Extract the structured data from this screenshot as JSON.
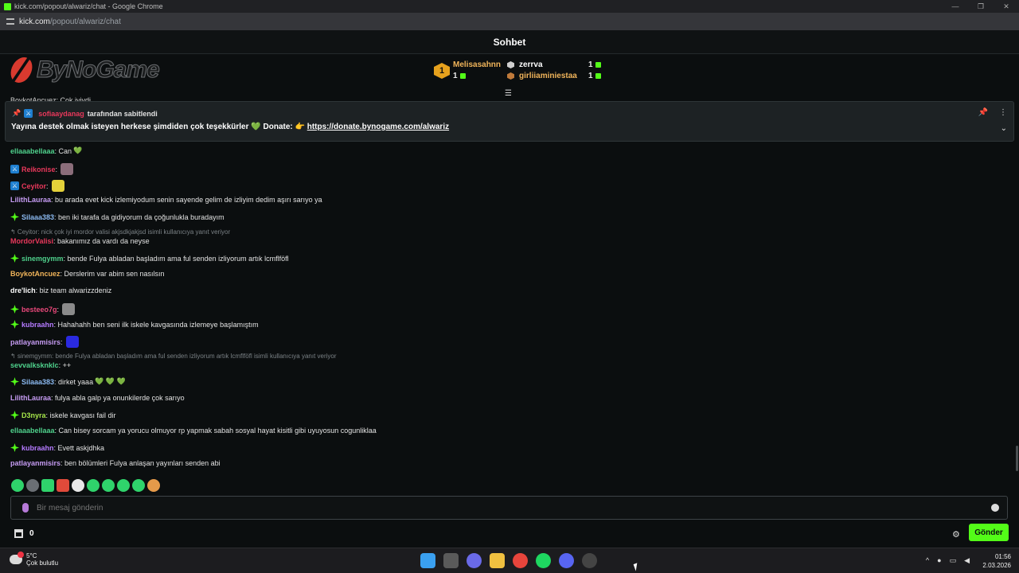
{
  "browser": {
    "window_title": "kick.com/popout/alwariz/chat - Google Chrome",
    "url_host": "kick.com",
    "url_path": "/popout/alwariz/chat"
  },
  "header": {
    "title": "Sohbet"
  },
  "logo": {
    "text": "ByNoGame"
  },
  "gifters": {
    "first": {
      "rank": "1",
      "name": "Melisasahnn",
      "count": "1"
    },
    "second": {
      "name": "zerrva",
      "count": "1"
    },
    "third": {
      "name": "girliiaminiestaa",
      "count": "1"
    }
  },
  "top_clip_text": "BoykotAncuez: Çok iyiydi",
  "pinned": {
    "pinned_by_user": "sofiaaydanag",
    "pinned_by_suffix": "tarafından sabitlendi",
    "text": "Yayına destek olmak isteyen herkese şimdiden çok teşekkürler 💚 Donate: 👉",
    "link": "https://donate.bynogame.com/alwariz"
  },
  "messages": [
    {
      "user": "ellaaabellaaa",
      "color": "#4fd18c",
      "text": ": Can",
      "heart": "💚"
    },
    {
      "user": "Reikonise",
      "color": "#e8385b",
      "text": ":",
      "mod": true,
      "emote": "#8b6d7a"
    },
    {
      "user": "Ceyitor",
      "color": "#e8385b",
      "text": ":",
      "mod": true,
      "emote": "#e3d13a"
    },
    {
      "user": "LilithLauraa",
      "color": "#c59bf2",
      "text": ": bu arada evet kick izlemiyodum senin sayende gelim de izliyim dedim aşırı sarıyo ya"
    },
    {
      "user": "Silaaa383",
      "color": "#8bb9f0",
      "text": ": ben iki tarafa da gidiyorum da çoğunlukla buradayım",
      "sub": true
    },
    {
      "reply": "Ceyitor: nick çok iyi mordor valisi akjsdkjakjsd isimli kullanıcıya yanıt veriyor"
    },
    {
      "user": "MordorValisi",
      "color": "#e8385b",
      "text": ": bakanımız da vardı da neyse"
    },
    {
      "user": "sinemgymm",
      "color": "#4fd18c",
      "text": ": bende Fulya abladan başladım ama ful senden izliyorum artık lcmflföfl",
      "sub": true
    },
    {
      "user": "BoykotAncuez",
      "color": "#f0b45a",
      "text": ": Derslerim var abim sen nasılsın"
    },
    {
      "user": "dre'lich",
      "color": "#ffffff",
      "text": ": biz team alwarizzdeniz"
    },
    {
      "user": "besteeo7g",
      "color": "#e8487a",
      "text": ":",
      "sub": true,
      "emote": "#8a8a8a"
    },
    {
      "user": "kubraahn",
      "color": "#b57bff",
      "text": ": Hahahahh ben seni ilk iskele kavgasında izlemeye başlamıştım",
      "sub": true
    },
    {
      "user": "patlayanmisirs",
      "color": "#c59bf2",
      "text": ":",
      "emote": "#2a2ae0"
    },
    {
      "reply": "sinemgymm: bende Fulya abladan başladım ama ful senden izliyorum artık lcmflföfl isimli kullanıcıya yanıt veriyor"
    },
    {
      "user": "sevvalksknklc",
      "color": "#4fd18c",
      "text": ": ++"
    },
    {
      "user": "Silaaa383",
      "color": "#8bb9f0",
      "text": ": dirket yaaa",
      "sub": true,
      "heart": "💚 💚 💚"
    },
    {
      "user": "LilithLauraa",
      "color": "#c59bf2",
      "text": ": fulya abla galp ya onunkilerde çok sarıyo"
    },
    {
      "user": "D3nyra",
      "color": "#a6e64a",
      "text": ": iskele kavgası fail dir",
      "sub": true
    },
    {
      "user": "ellaaabellaaa",
      "color": "#4fd18c",
      "text": ": Can bisey sorcam ya yorucu olmuyor rp yapmak sabah sosyal hayat kisitli gibi uyuyosun cogunliklaa"
    },
    {
      "user": "kubraahn",
      "color": "#b57bff",
      "text": ": Evett askjdhka",
      "sub": true
    },
    {
      "user": "patlayanmisirs",
      "color": "#c59bf2",
      "text": ": ben bölümleri Fulya anlaşan yayınları senden abi"
    }
  ],
  "input": {
    "placeholder": "Bir mesaj gönderin"
  },
  "bottom": {
    "store_count": "0",
    "send_label": "Gönder"
  },
  "taskbar": {
    "temp": "5°C",
    "weather": "Çok bulutlu",
    "time": "01:56",
    "date": "2.03.2026"
  }
}
